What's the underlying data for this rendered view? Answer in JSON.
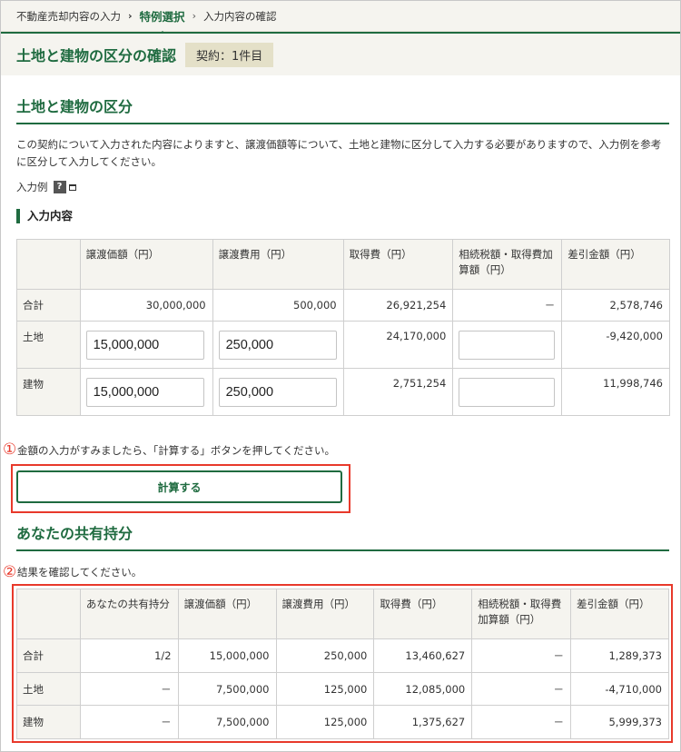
{
  "breadcrumb": {
    "step1": "不動産売却内容の入力",
    "step2": "特例選択",
    "step3": "入力内容の確認"
  },
  "header": {
    "title": "土地と建物の区分の確認",
    "contract_badge": "契約：1件目"
  },
  "section1": {
    "heading": "土地と建物の区分",
    "description": "この契約について入力された内容によりますと、譲渡価額等について、土地と建物に区分して入力する必要がありますので、入力例を参考に区分して入力してください。",
    "example_label": "入力例",
    "help_icon": "?",
    "subheading": "入力内容"
  },
  "input_table": {
    "columns": [
      "譲渡価額（円）",
      "譲渡費用（円）",
      "取得費（円）",
      "相続税額・取得費加算額（円）",
      "差引金額（円）"
    ],
    "rows": [
      {
        "label": "合計",
        "price": "30,000,000",
        "expense": "500,000",
        "acquisition": "26,921,254",
        "inheritance": "－",
        "difference": "2,578,746"
      },
      {
        "label": "土地",
        "price": "15,000,000",
        "expense": "250,000",
        "acquisition": "24,170,000",
        "inheritance": "",
        "difference": "-9,420,000"
      },
      {
        "label": "建物",
        "price": "15,000,000",
        "expense": "250,000",
        "acquisition": "2,751,254",
        "inheritance": "",
        "difference": "11,998,746"
      }
    ]
  },
  "calc": {
    "marker": "①",
    "instruction": "金額の入力がすみましたら、「計算する」ボタンを押してください。",
    "button_label": "計算する"
  },
  "section2": {
    "heading": "あなたの共有持分",
    "marker": "②",
    "instruction": "結果を確認してください。"
  },
  "share_table": {
    "columns": [
      "あなたの共有持分",
      "譲渡価額（円）",
      "譲渡費用（円）",
      "取得費（円）",
      "相続税額・取得費加算額（円）",
      "差引金額（円）"
    ],
    "rows": [
      {
        "label": "合計",
        "share": "1/2",
        "price": "15,000,000",
        "expense": "250,000",
        "acquisition": "13,460,627",
        "inheritance": "－",
        "difference": "1,289,373"
      },
      {
        "label": "土地",
        "share": "－",
        "price": "7,500,000",
        "expense": "125,000",
        "acquisition": "12,085,000",
        "inheritance": "－",
        "difference": "-4,710,000"
      },
      {
        "label": "建物",
        "share": "－",
        "price": "7,500,000",
        "expense": "125,000",
        "acquisition": "1,375,627",
        "inheritance": "－",
        "difference": "5,999,373"
      }
    ]
  },
  "colors": {
    "accent_green": "#1f6b40",
    "highlight_red": "#e8392b",
    "panel_beige": "#f5f4ef",
    "badge_beige": "#e4e0c8"
  }
}
